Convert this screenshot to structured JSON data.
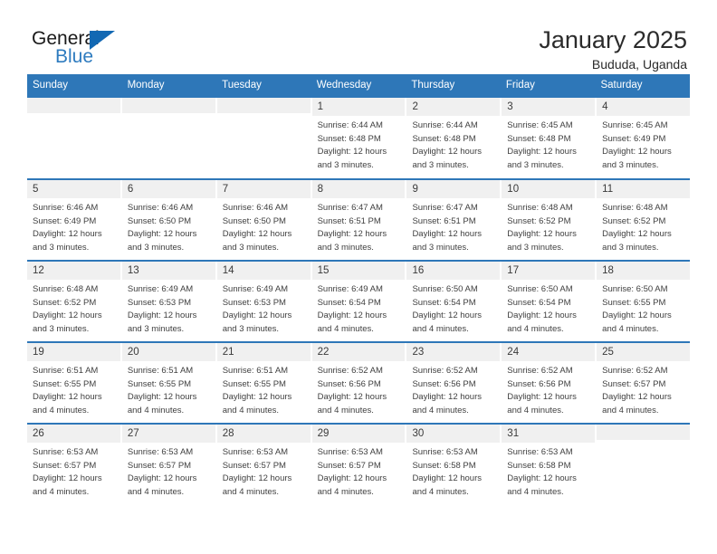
{
  "brand": {
    "word1": "General",
    "word2": "Blue",
    "logo_icon": "triangle-logo-icon"
  },
  "header": {
    "title": "January 2025",
    "location": "Bududa, Uganda"
  },
  "theme": {
    "header_blue": "#2e77b8",
    "daynum_gray": "#f0f0f0",
    "brand_blue": "#2e7bbf",
    "text": "#404040"
  },
  "calendar": {
    "weekdays": [
      "Sunday",
      "Monday",
      "Tuesday",
      "Wednesday",
      "Thursday",
      "Friday",
      "Saturday"
    ],
    "labels": {
      "sunrise": "Sunrise:",
      "sunset": "Sunset:",
      "daylight": "Daylight:"
    },
    "weeks": [
      [
        {
          "day": "",
          "sunrise": "",
          "sunset": "",
          "daylight": "",
          "empty": true
        },
        {
          "day": "",
          "sunrise": "",
          "sunset": "",
          "daylight": "",
          "empty": true
        },
        {
          "day": "",
          "sunrise": "",
          "sunset": "",
          "daylight": "",
          "empty": true
        },
        {
          "day": "1",
          "sunrise": "Sunrise: 6:44 AM",
          "sunset": "Sunset: 6:48 PM",
          "daylight": "Daylight: 12 hours and 3 minutes."
        },
        {
          "day": "2",
          "sunrise": "Sunrise: 6:44 AM",
          "sunset": "Sunset: 6:48 PM",
          "daylight": "Daylight: 12 hours and 3 minutes."
        },
        {
          "day": "3",
          "sunrise": "Sunrise: 6:45 AM",
          "sunset": "Sunset: 6:48 PM",
          "daylight": "Daylight: 12 hours and 3 minutes."
        },
        {
          "day": "4",
          "sunrise": "Sunrise: 6:45 AM",
          "sunset": "Sunset: 6:49 PM",
          "daylight": "Daylight: 12 hours and 3 minutes."
        }
      ],
      [
        {
          "day": "5",
          "sunrise": "Sunrise: 6:46 AM",
          "sunset": "Sunset: 6:49 PM",
          "daylight": "Daylight: 12 hours and 3 minutes."
        },
        {
          "day": "6",
          "sunrise": "Sunrise: 6:46 AM",
          "sunset": "Sunset: 6:50 PM",
          "daylight": "Daylight: 12 hours and 3 minutes."
        },
        {
          "day": "7",
          "sunrise": "Sunrise: 6:46 AM",
          "sunset": "Sunset: 6:50 PM",
          "daylight": "Daylight: 12 hours and 3 minutes."
        },
        {
          "day": "8",
          "sunrise": "Sunrise: 6:47 AM",
          "sunset": "Sunset: 6:51 PM",
          "daylight": "Daylight: 12 hours and 3 minutes."
        },
        {
          "day": "9",
          "sunrise": "Sunrise: 6:47 AM",
          "sunset": "Sunset: 6:51 PM",
          "daylight": "Daylight: 12 hours and 3 minutes."
        },
        {
          "day": "10",
          "sunrise": "Sunrise: 6:48 AM",
          "sunset": "Sunset: 6:52 PM",
          "daylight": "Daylight: 12 hours and 3 minutes."
        },
        {
          "day": "11",
          "sunrise": "Sunrise: 6:48 AM",
          "sunset": "Sunset: 6:52 PM",
          "daylight": "Daylight: 12 hours and 3 minutes."
        }
      ],
      [
        {
          "day": "12",
          "sunrise": "Sunrise: 6:48 AM",
          "sunset": "Sunset: 6:52 PM",
          "daylight": "Daylight: 12 hours and 3 minutes."
        },
        {
          "day": "13",
          "sunrise": "Sunrise: 6:49 AM",
          "sunset": "Sunset: 6:53 PM",
          "daylight": "Daylight: 12 hours and 3 minutes."
        },
        {
          "day": "14",
          "sunrise": "Sunrise: 6:49 AM",
          "sunset": "Sunset: 6:53 PM",
          "daylight": "Daylight: 12 hours and 3 minutes."
        },
        {
          "day": "15",
          "sunrise": "Sunrise: 6:49 AM",
          "sunset": "Sunset: 6:54 PM",
          "daylight": "Daylight: 12 hours and 4 minutes."
        },
        {
          "day": "16",
          "sunrise": "Sunrise: 6:50 AM",
          "sunset": "Sunset: 6:54 PM",
          "daylight": "Daylight: 12 hours and 4 minutes."
        },
        {
          "day": "17",
          "sunrise": "Sunrise: 6:50 AM",
          "sunset": "Sunset: 6:54 PM",
          "daylight": "Daylight: 12 hours and 4 minutes."
        },
        {
          "day": "18",
          "sunrise": "Sunrise: 6:50 AM",
          "sunset": "Sunset: 6:55 PM",
          "daylight": "Daylight: 12 hours and 4 minutes."
        }
      ],
      [
        {
          "day": "19",
          "sunrise": "Sunrise: 6:51 AM",
          "sunset": "Sunset: 6:55 PM",
          "daylight": "Daylight: 12 hours and 4 minutes."
        },
        {
          "day": "20",
          "sunrise": "Sunrise: 6:51 AM",
          "sunset": "Sunset: 6:55 PM",
          "daylight": "Daylight: 12 hours and 4 minutes."
        },
        {
          "day": "21",
          "sunrise": "Sunrise: 6:51 AM",
          "sunset": "Sunset: 6:55 PM",
          "daylight": "Daylight: 12 hours and 4 minutes."
        },
        {
          "day": "22",
          "sunrise": "Sunrise: 6:52 AM",
          "sunset": "Sunset: 6:56 PM",
          "daylight": "Daylight: 12 hours and 4 minutes."
        },
        {
          "day": "23",
          "sunrise": "Sunrise: 6:52 AM",
          "sunset": "Sunset: 6:56 PM",
          "daylight": "Daylight: 12 hours and 4 minutes."
        },
        {
          "day": "24",
          "sunrise": "Sunrise: 6:52 AM",
          "sunset": "Sunset: 6:56 PM",
          "daylight": "Daylight: 12 hours and 4 minutes."
        },
        {
          "day": "25",
          "sunrise": "Sunrise: 6:52 AM",
          "sunset": "Sunset: 6:57 PM",
          "daylight": "Daylight: 12 hours and 4 minutes."
        }
      ],
      [
        {
          "day": "26",
          "sunrise": "Sunrise: 6:53 AM",
          "sunset": "Sunset: 6:57 PM",
          "daylight": "Daylight: 12 hours and 4 minutes."
        },
        {
          "day": "27",
          "sunrise": "Sunrise: 6:53 AM",
          "sunset": "Sunset: 6:57 PM",
          "daylight": "Daylight: 12 hours and 4 minutes."
        },
        {
          "day": "28",
          "sunrise": "Sunrise: 6:53 AM",
          "sunset": "Sunset: 6:57 PM",
          "daylight": "Daylight: 12 hours and 4 minutes."
        },
        {
          "day": "29",
          "sunrise": "Sunrise: 6:53 AM",
          "sunset": "Sunset: 6:57 PM",
          "daylight": "Daylight: 12 hours and 4 minutes."
        },
        {
          "day": "30",
          "sunrise": "Sunrise: 6:53 AM",
          "sunset": "Sunset: 6:58 PM",
          "daylight": "Daylight: 12 hours and 4 minutes."
        },
        {
          "day": "31",
          "sunrise": "Sunrise: 6:53 AM",
          "sunset": "Sunset: 6:58 PM",
          "daylight": "Daylight: 12 hours and 4 minutes."
        },
        {
          "day": "",
          "sunrise": "",
          "sunset": "",
          "daylight": "",
          "empty": true
        }
      ]
    ]
  }
}
